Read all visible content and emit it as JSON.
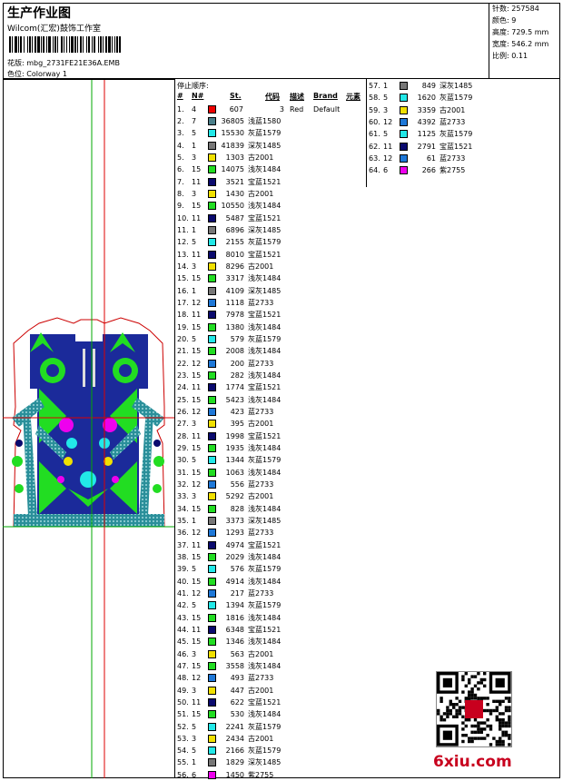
{
  "header": {
    "title": "生产作业图",
    "studio": "Wilcom(汇宏)鼓饰工作室",
    "design_label": "花版:",
    "design_name": "mbg_2731FE21E36A.EMB",
    "colorway_label": "色位:",
    "colorway_name": "Colorway 1"
  },
  "stats": [
    {
      "label": "针数:",
      "value": "257584"
    },
    {
      "label": "颜色:",
      "value": "9"
    },
    {
      "label": "高度:",
      "value": "729.5 mm"
    },
    {
      "label": "宽度:",
      "value": "546.2 mm"
    },
    {
      "label": "比例:",
      "value": "0.11"
    }
  ],
  "stop_sequence": {
    "title": "停止顺序:",
    "headers": {
      "num": "#",
      "needle": "N#",
      "st": "St.",
      "code": "代码",
      "desc": "描述",
      "brand": "Brand",
      "element": "元素"
    },
    "first_row": {
      "num": "1.",
      "needle": "4",
      "color": "#ee0000",
      "st": "607",
      "code": "3",
      "desc": "Red",
      "brand": "Default"
    },
    "rows": [
      {
        "num": "2.",
        "needle": "7",
        "color": "#4a7f8a",
        "st": "36805",
        "desc": "浅蓝1580"
      },
      {
        "num": "3.",
        "needle": "5",
        "color": "#22e8e8",
        "st": "15530",
        "desc": "灰蓝1579"
      },
      {
        "num": "4.",
        "needle": "1",
        "color": "#777777",
        "st": "41839",
        "desc": "深灰1485"
      },
      {
        "num": "5.",
        "needle": "3",
        "color": "#f0e000",
        "st": "1303",
        "desc": "古2001"
      },
      {
        "num": "6.",
        "needle": "15",
        "color": "#22dd22",
        "st": "14075",
        "desc": "浅灰1484"
      },
      {
        "num": "7.",
        "needle": "11",
        "color": "#0a0a6e",
        "st": "3521",
        "desc": "宝蓝1521"
      },
      {
        "num": "8.",
        "needle": "3",
        "color": "#f0e000",
        "st": "1430",
        "desc": "古2001"
      },
      {
        "num": "9.",
        "needle": "15",
        "color": "#22dd22",
        "st": "10550",
        "desc": "浅灰1484"
      },
      {
        "num": "10.",
        "needle": "11",
        "color": "#0a0a6e",
        "st": "5487",
        "desc": "宝蓝1521"
      },
      {
        "num": "11.",
        "needle": "1",
        "color": "#777777",
        "st": "6896",
        "desc": "深灰1485"
      },
      {
        "num": "12.",
        "needle": "5",
        "color": "#22e8e8",
        "st": "2155",
        "desc": "灰蓝1579"
      },
      {
        "num": "13.",
        "needle": "11",
        "color": "#0a0a6e",
        "st": "8010",
        "desc": "宝蓝1521"
      },
      {
        "num": "14.",
        "needle": "3",
        "color": "#f0e000",
        "st": "8296",
        "desc": "古2001"
      },
      {
        "num": "15.",
        "needle": "15",
        "color": "#22dd22",
        "st": "3317",
        "desc": "浅灰1484"
      },
      {
        "num": "16.",
        "needle": "1",
        "color": "#777777",
        "st": "4109",
        "desc": "深灰1485"
      },
      {
        "num": "17.",
        "needle": "12",
        "color": "#1e78d8",
        "st": "1118",
        "desc": "蓝2733"
      },
      {
        "num": "18.",
        "needle": "11",
        "color": "#0a0a6e",
        "st": "7978",
        "desc": "宝蓝1521"
      },
      {
        "num": "19.",
        "needle": "15",
        "color": "#22dd22",
        "st": "1380",
        "desc": "浅灰1484"
      },
      {
        "num": "20.",
        "needle": "5",
        "color": "#22e8e8",
        "st": "579",
        "desc": "灰蓝1579"
      },
      {
        "num": "21.",
        "needle": "15",
        "color": "#22dd22",
        "st": "2008",
        "desc": "浅灰1484"
      },
      {
        "num": "22.",
        "needle": "12",
        "color": "#1e78d8",
        "st": "200",
        "desc": "蓝2733"
      },
      {
        "num": "23.",
        "needle": "15",
        "color": "#22dd22",
        "st": "282",
        "desc": "浅灰1484"
      },
      {
        "num": "24.",
        "needle": "11",
        "color": "#0a0a6e",
        "st": "1774",
        "desc": "宝蓝1521"
      },
      {
        "num": "25.",
        "needle": "15",
        "color": "#22dd22",
        "st": "5423",
        "desc": "浅灰1484"
      },
      {
        "num": "26.",
        "needle": "12",
        "color": "#1e78d8",
        "st": "423",
        "desc": "蓝2733"
      },
      {
        "num": "27.",
        "needle": "3",
        "color": "#f0e000",
        "st": "395",
        "desc": "古2001"
      },
      {
        "num": "28.",
        "needle": "11",
        "color": "#0a0a6e",
        "st": "1998",
        "desc": "宝蓝1521"
      },
      {
        "num": "29.",
        "needle": "15",
        "color": "#22dd22",
        "st": "1935",
        "desc": "浅灰1484"
      },
      {
        "num": "30.",
        "needle": "5",
        "color": "#22e8e8",
        "st": "1344",
        "desc": "灰蓝1579"
      },
      {
        "num": "31.",
        "needle": "15",
        "color": "#22dd22",
        "st": "1063",
        "desc": "浅灰1484"
      },
      {
        "num": "32.",
        "needle": "12",
        "color": "#1e78d8",
        "st": "556",
        "desc": "蓝2733"
      },
      {
        "num": "33.",
        "needle": "3",
        "color": "#f0e000",
        "st": "5292",
        "desc": "古2001"
      },
      {
        "num": "34.",
        "needle": "15",
        "color": "#22dd22",
        "st": "828",
        "desc": "浅灰1484"
      },
      {
        "num": "35.",
        "needle": "1",
        "color": "#777777",
        "st": "3373",
        "desc": "深灰1485"
      },
      {
        "num": "36.",
        "needle": "12",
        "color": "#1e78d8",
        "st": "1293",
        "desc": "蓝2733"
      },
      {
        "num": "37.",
        "needle": "11",
        "color": "#0a0a6e",
        "st": "4974",
        "desc": "宝蓝1521"
      },
      {
        "num": "38.",
        "needle": "15",
        "color": "#22dd22",
        "st": "2029",
        "desc": "浅灰1484"
      },
      {
        "num": "39.",
        "needle": "5",
        "color": "#22e8e8",
        "st": "576",
        "desc": "灰蓝1579"
      },
      {
        "num": "40.",
        "needle": "15",
        "color": "#22dd22",
        "st": "4914",
        "desc": "浅灰1484"
      },
      {
        "num": "41.",
        "needle": "12",
        "color": "#1e78d8",
        "st": "217",
        "desc": "蓝2733"
      },
      {
        "num": "42.",
        "needle": "5",
        "color": "#22e8e8",
        "st": "1394",
        "desc": "灰蓝1579"
      },
      {
        "num": "43.",
        "needle": "15",
        "color": "#22dd22",
        "st": "1816",
        "desc": "浅灰1484"
      },
      {
        "num": "44.",
        "needle": "11",
        "color": "#0a0a6e",
        "st": "6348",
        "desc": "宝蓝1521"
      },
      {
        "num": "45.",
        "needle": "15",
        "color": "#22dd22",
        "st": "1346",
        "desc": "浅灰1484"
      },
      {
        "num": "46.",
        "needle": "3",
        "color": "#f0e000",
        "st": "563",
        "desc": "古2001"
      },
      {
        "num": "47.",
        "needle": "15",
        "color": "#22dd22",
        "st": "3558",
        "desc": "浅灰1484"
      },
      {
        "num": "48.",
        "needle": "12",
        "color": "#1e78d8",
        "st": "493",
        "desc": "蓝2733"
      },
      {
        "num": "49.",
        "needle": "3",
        "color": "#f0e000",
        "st": "447",
        "desc": "古2001"
      },
      {
        "num": "50.",
        "needle": "11",
        "color": "#0a0a6e",
        "st": "622",
        "desc": "宝蓝1521"
      },
      {
        "num": "51.",
        "needle": "15",
        "color": "#22dd22",
        "st": "530",
        "desc": "浅灰1484"
      },
      {
        "num": "52.",
        "needle": "5",
        "color": "#22e8e8",
        "st": "2241",
        "desc": "灰蓝1579"
      },
      {
        "num": "53.",
        "needle": "3",
        "color": "#f0e000",
        "st": "2434",
        "desc": "古2001"
      },
      {
        "num": "54.",
        "needle": "5",
        "color": "#22e8e8",
        "st": "2166",
        "desc": "灰蓝1579"
      },
      {
        "num": "55.",
        "needle": "1",
        "color": "#777777",
        "st": "1829",
        "desc": "深灰1485"
      },
      {
        "num": "56.",
        "needle": "6",
        "color": "#ee00ee",
        "st": "1450",
        "desc": "紫2755"
      }
    ],
    "rows2": [
      {
        "num": "57.",
        "needle": "1",
        "color": "#777777",
        "st": "849",
        "desc": "深灰1485"
      },
      {
        "num": "58.",
        "needle": "5",
        "color": "#22e8e8",
        "st": "1620",
        "desc": "灰蓝1579"
      },
      {
        "num": "59.",
        "needle": "3",
        "color": "#f0e000",
        "st": "3359",
        "desc": "古2001"
      },
      {
        "num": "60.",
        "needle": "12",
        "color": "#1e78d8",
        "st": "4392",
        "desc": "蓝2733"
      },
      {
        "num": "61.",
        "needle": "5",
        "color": "#22e8e8",
        "st": "1125",
        "desc": "灰蓝1579"
      },
      {
        "num": "62.",
        "needle": "11",
        "color": "#0a0a6e",
        "st": "2791",
        "desc": "宝蓝1521"
      },
      {
        "num": "63.",
        "needle": "12",
        "color": "#1e78d8",
        "st": "61",
        "desc": "蓝2733"
      },
      {
        "num": "64.",
        "needle": "6",
        "color": "#ee00ee",
        "st": "266",
        "desc": "紫2755"
      }
    ]
  },
  "watermark": {
    "text": "6xiu.com"
  }
}
